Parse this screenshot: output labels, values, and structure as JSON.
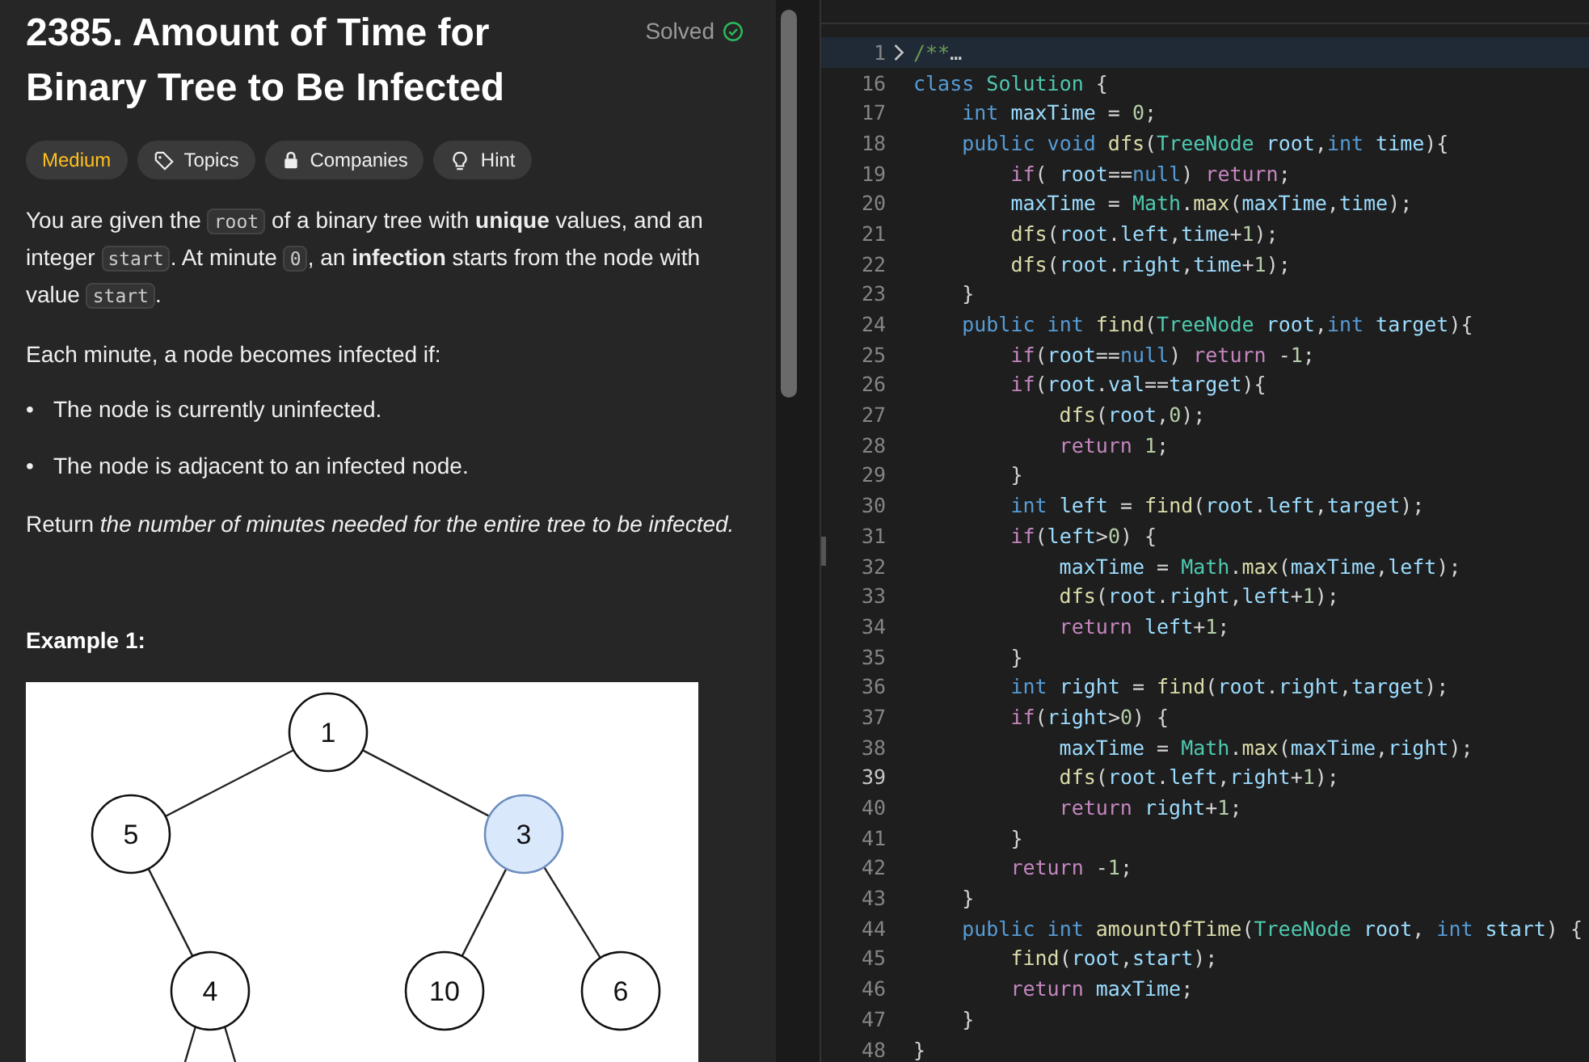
{
  "problem": {
    "title": "2385. Amount of Time for Binary Tree to Be Infected",
    "status": "Solved",
    "solved": true,
    "tags": [
      {
        "kind": "difficulty",
        "label": "Medium"
      },
      {
        "kind": "topics",
        "label": "Topics"
      },
      {
        "kind": "companies",
        "label": "Companies"
      },
      {
        "kind": "hint",
        "label": "Hint"
      }
    ],
    "paragraphs": [
      [
        {
          "text": "You are given the ",
          "kind": "text"
        },
        {
          "text": "root",
          "kind": "code"
        },
        {
          "text": " of a binary tree with **unique** values, and an integer ",
          "kind": "text"
        },
        {
          "text": "start",
          "kind": "code"
        },
        {
          "text": ". At minute ",
          "kind": "text"
        },
        {
          "text": "0",
          "kind": "code"
        },
        {
          "text": ", an **infection** starts from the node with value ",
          "kind": "text"
        },
        {
          "text": "start",
          "kind": "code"
        },
        {
          "text": ".",
          "kind": "text"
        }
      ],
      [
        {
          "text": "Each minute, a node becomes infected if:",
          "kind": "text"
        }
      ]
    ],
    "bullets": [
      {
        "marker": "•",
        "text": "The node is currently uninfected."
      },
      {
        "marker": "•",
        "text": "The node is adjacent to an infected node."
      }
    ],
    "closing": "Return *the number of minutes needed for the entire tree to be infected.*",
    "example_heading": "Example 1:",
    "tree": {
      "label": "1",
      "highlighted": false,
      "children": [
        {
          "label": "5",
          "highlighted": false,
          "children": [
            {
              "label": "4",
              "highlighted": false
            }
          ]
        },
        {
          "label": "3",
          "highlighted": true,
          "children": [
            {
              "label": "10",
              "highlighted": false
            },
            {
              "label": "6",
              "highlighted": false
            }
          ]
        }
      ]
    }
  },
  "editor": {
    "lines": [
      {
        "n": "1",
        "current": false,
        "collapsed": true,
        "tokens": [
          {
            "text": "/**",
            "kind": "comment"
          },
          {
            "text": "…",
            "kind": "plain"
          }
        ]
      },
      {
        "n": "16",
        "current": false,
        "collapsed": false,
        "tokens": [
          {
            "text": "class",
            "kind": "keyword"
          },
          {
            "text": " Solution",
            "kind": "type"
          },
          {
            "text": " {",
            "kind": "plain"
          }
        ]
      },
      {
        "n": "17",
        "current": false,
        "collapsed": false,
        "tokens": [
          {
            "text": "    int",
            "kind": "keyword"
          },
          {
            "text": " maxTime",
            "kind": "var"
          },
          {
            "text": " =",
            "kind": "plain"
          },
          {
            "text": " 0",
            "kind": "number"
          },
          {
            "text": ";",
            "kind": "plain"
          }
        ]
      },
      {
        "n": "18",
        "current": false,
        "collapsed": false,
        "tokens": [
          {
            "text": "    public",
            "kind": "keyword"
          },
          {
            "text": " void",
            "kind": "keyword"
          },
          {
            "text": " dfs",
            "kind": "func"
          },
          {
            "text": "(",
            "kind": "plain"
          },
          {
            "text": "TreeNode",
            "kind": "type"
          },
          {
            "text": " root",
            "kind": "var"
          },
          {
            "text": ",",
            "kind": "plain"
          },
          {
            "text": "int",
            "kind": "keyword"
          },
          {
            "text": " time",
            "kind": "var"
          },
          {
            "text": "){",
            "kind": "plain"
          }
        ]
      },
      {
        "n": "19",
        "current": false,
        "collapsed": false,
        "tokens": [
          {
            "text": "        if",
            "kind": "control"
          },
          {
            "text": "(",
            "kind": "plain"
          },
          {
            "text": " root",
            "kind": "var"
          },
          {
            "text": "==",
            "kind": "plain"
          },
          {
            "text": "null",
            "kind": "keyword"
          },
          {
            "text": ")",
            "kind": "plain"
          },
          {
            "text": " return",
            "kind": "control"
          },
          {
            "text": ";",
            "kind": "plain"
          }
        ]
      },
      {
        "n": "20",
        "current": false,
        "collapsed": false,
        "tokens": [
          {
            "text": "        maxTime",
            "kind": "var"
          },
          {
            "text": " =",
            "kind": "plain"
          },
          {
            "text": " Math",
            "kind": "type"
          },
          {
            "text": ".",
            "kind": "plain"
          },
          {
            "text": "max",
            "kind": "func"
          },
          {
            "text": "(",
            "kind": "plain"
          },
          {
            "text": "maxTime",
            "kind": "var"
          },
          {
            "text": ",",
            "kind": "plain"
          },
          {
            "text": "time",
            "kind": "var"
          },
          {
            "text": ");",
            "kind": "plain"
          }
        ]
      },
      {
        "n": "21",
        "current": false,
        "collapsed": false,
        "tokens": [
          {
            "text": "        dfs",
            "kind": "func"
          },
          {
            "text": "(",
            "kind": "plain"
          },
          {
            "text": "root",
            "kind": "var"
          },
          {
            "text": ".",
            "kind": "plain"
          },
          {
            "text": "left",
            "kind": "var"
          },
          {
            "text": ",",
            "kind": "plain"
          },
          {
            "text": "time",
            "kind": "var"
          },
          {
            "text": "+",
            "kind": "plain"
          },
          {
            "text": "1",
            "kind": "number"
          },
          {
            "text": ");",
            "kind": "plain"
          }
        ]
      },
      {
        "n": "22",
        "current": false,
        "collapsed": false,
        "tokens": [
          {
            "text": "        dfs",
            "kind": "func"
          },
          {
            "text": "(",
            "kind": "plain"
          },
          {
            "text": "root",
            "kind": "var"
          },
          {
            "text": ".",
            "kind": "plain"
          },
          {
            "text": "right",
            "kind": "var"
          },
          {
            "text": ",",
            "kind": "plain"
          },
          {
            "text": "time",
            "kind": "var"
          },
          {
            "text": "+",
            "kind": "plain"
          },
          {
            "text": "1",
            "kind": "number"
          },
          {
            "text": ");",
            "kind": "plain"
          }
        ]
      },
      {
        "n": "23",
        "current": false,
        "collapsed": false,
        "tokens": [
          {
            "text": "    }",
            "kind": "plain"
          }
        ]
      },
      {
        "n": "24",
        "current": false,
        "collapsed": false,
        "tokens": [
          {
            "text": "    public",
            "kind": "keyword"
          },
          {
            "text": " int",
            "kind": "keyword"
          },
          {
            "text": " find",
            "kind": "func"
          },
          {
            "text": "(",
            "kind": "plain"
          },
          {
            "text": "TreeNode",
            "kind": "type"
          },
          {
            "text": " root",
            "kind": "var"
          },
          {
            "text": ",",
            "kind": "plain"
          },
          {
            "text": "int",
            "kind": "keyword"
          },
          {
            "text": " target",
            "kind": "var"
          },
          {
            "text": "){",
            "kind": "plain"
          }
        ]
      },
      {
        "n": "25",
        "current": false,
        "collapsed": false,
        "tokens": [
          {
            "text": "        if",
            "kind": "control"
          },
          {
            "text": "(",
            "kind": "plain"
          },
          {
            "text": "root",
            "kind": "var"
          },
          {
            "text": "==",
            "kind": "plain"
          },
          {
            "text": "null",
            "kind": "keyword"
          },
          {
            "text": ")",
            "kind": "plain"
          },
          {
            "text": " return",
            "kind": "control"
          },
          {
            "text": " -",
            "kind": "plain"
          },
          {
            "text": "1",
            "kind": "number"
          },
          {
            "text": ";",
            "kind": "plain"
          }
        ]
      },
      {
        "n": "26",
        "current": false,
        "collapsed": false,
        "tokens": [
          {
            "text": "        if",
            "kind": "control"
          },
          {
            "text": "(",
            "kind": "plain"
          },
          {
            "text": "root",
            "kind": "var"
          },
          {
            "text": ".",
            "kind": "plain"
          },
          {
            "text": "val",
            "kind": "var"
          },
          {
            "text": "==",
            "kind": "plain"
          },
          {
            "text": "target",
            "kind": "var"
          },
          {
            "text": "){",
            "kind": "plain"
          }
        ]
      },
      {
        "n": "27",
        "current": false,
        "collapsed": false,
        "tokens": [
          {
            "text": "            dfs",
            "kind": "func"
          },
          {
            "text": "(",
            "kind": "plain"
          },
          {
            "text": "root",
            "kind": "var"
          },
          {
            "text": ",",
            "kind": "plain"
          },
          {
            "text": "0",
            "kind": "number"
          },
          {
            "text": ");",
            "kind": "plain"
          }
        ]
      },
      {
        "n": "28",
        "current": false,
        "collapsed": false,
        "tokens": [
          {
            "text": "            return",
            "kind": "control"
          },
          {
            "text": " 1",
            "kind": "number"
          },
          {
            "text": ";",
            "kind": "plain"
          }
        ]
      },
      {
        "n": "29",
        "current": false,
        "collapsed": false,
        "tokens": [
          {
            "text": "        }",
            "kind": "plain"
          }
        ]
      },
      {
        "n": "30",
        "current": false,
        "collapsed": false,
        "tokens": [
          {
            "text": "        int",
            "kind": "keyword"
          },
          {
            "text": " left",
            "kind": "var"
          },
          {
            "text": " =",
            "kind": "plain"
          },
          {
            "text": " find",
            "kind": "func"
          },
          {
            "text": "(",
            "kind": "plain"
          },
          {
            "text": "root",
            "kind": "var"
          },
          {
            "text": ".",
            "kind": "plain"
          },
          {
            "text": "left",
            "kind": "var"
          },
          {
            "text": ",",
            "kind": "plain"
          },
          {
            "text": "target",
            "kind": "var"
          },
          {
            "text": ");",
            "kind": "plain"
          }
        ]
      },
      {
        "n": "31",
        "current": false,
        "collapsed": false,
        "tokens": [
          {
            "text": "        if",
            "kind": "control"
          },
          {
            "text": "(",
            "kind": "plain"
          },
          {
            "text": "left",
            "kind": "var"
          },
          {
            "text": ">",
            "kind": "plain"
          },
          {
            "text": "0",
            "kind": "number"
          },
          {
            "text": ") {",
            "kind": "plain"
          }
        ]
      },
      {
        "n": "32",
        "current": false,
        "collapsed": false,
        "tokens": [
          {
            "text": "            maxTime",
            "kind": "var"
          },
          {
            "text": " =",
            "kind": "plain"
          },
          {
            "text": " Math",
            "kind": "type"
          },
          {
            "text": ".",
            "kind": "plain"
          },
          {
            "text": "max",
            "kind": "func"
          },
          {
            "text": "(",
            "kind": "plain"
          },
          {
            "text": "maxTime",
            "kind": "var"
          },
          {
            "text": ",",
            "kind": "plain"
          },
          {
            "text": "left",
            "kind": "var"
          },
          {
            "text": ");",
            "kind": "plain"
          }
        ]
      },
      {
        "n": "33",
        "current": false,
        "collapsed": false,
        "tokens": [
          {
            "text": "            dfs",
            "kind": "func"
          },
          {
            "text": "(",
            "kind": "plain"
          },
          {
            "text": "root",
            "kind": "var"
          },
          {
            "text": ".",
            "kind": "plain"
          },
          {
            "text": "right",
            "kind": "var"
          },
          {
            "text": ",",
            "kind": "plain"
          },
          {
            "text": "left",
            "kind": "var"
          },
          {
            "text": "+",
            "kind": "plain"
          },
          {
            "text": "1",
            "kind": "number"
          },
          {
            "text": ");",
            "kind": "plain"
          }
        ]
      },
      {
        "n": "34",
        "current": false,
        "collapsed": false,
        "tokens": [
          {
            "text": "            return",
            "kind": "control"
          },
          {
            "text": " left",
            "kind": "var"
          },
          {
            "text": "+",
            "kind": "plain"
          },
          {
            "text": "1",
            "kind": "number"
          },
          {
            "text": ";",
            "kind": "plain"
          }
        ]
      },
      {
        "n": "35",
        "current": false,
        "collapsed": false,
        "tokens": [
          {
            "text": "        }",
            "kind": "plain"
          }
        ]
      },
      {
        "n": "36",
        "current": false,
        "collapsed": false,
        "tokens": [
          {
            "text": "        int",
            "kind": "keyword"
          },
          {
            "text": " right",
            "kind": "var"
          },
          {
            "text": " =",
            "kind": "plain"
          },
          {
            "text": " find",
            "kind": "func"
          },
          {
            "text": "(",
            "kind": "plain"
          },
          {
            "text": "root",
            "kind": "var"
          },
          {
            "text": ".",
            "kind": "plain"
          },
          {
            "text": "right",
            "kind": "var"
          },
          {
            "text": ",",
            "kind": "plain"
          },
          {
            "text": "target",
            "kind": "var"
          },
          {
            "text": ");",
            "kind": "plain"
          }
        ]
      },
      {
        "n": "37",
        "current": false,
        "collapsed": false,
        "tokens": [
          {
            "text": "        if",
            "kind": "control"
          },
          {
            "text": "(",
            "kind": "plain"
          },
          {
            "text": "right",
            "kind": "var"
          },
          {
            "text": ">",
            "kind": "plain"
          },
          {
            "text": "0",
            "kind": "number"
          },
          {
            "text": ") {",
            "kind": "plain"
          }
        ]
      },
      {
        "n": "38",
        "current": false,
        "collapsed": false,
        "tokens": [
          {
            "text": "            maxTime",
            "kind": "var"
          },
          {
            "text": " =",
            "kind": "plain"
          },
          {
            "text": " Math",
            "kind": "type"
          },
          {
            "text": ".",
            "kind": "plain"
          },
          {
            "text": "max",
            "kind": "func"
          },
          {
            "text": "(",
            "kind": "plain"
          },
          {
            "text": "maxTime",
            "kind": "var"
          },
          {
            "text": ",",
            "kind": "plain"
          },
          {
            "text": "right",
            "kind": "var"
          },
          {
            "text": ");",
            "kind": "plain"
          }
        ]
      },
      {
        "n": "39",
        "current": true,
        "collapsed": false,
        "tokens": [
          {
            "text": "            dfs",
            "kind": "func"
          },
          {
            "text": "(",
            "kind": "plain"
          },
          {
            "text": "root",
            "kind": "var"
          },
          {
            "text": ".",
            "kind": "plain"
          },
          {
            "text": "left",
            "kind": "var"
          },
          {
            "text": ",",
            "kind": "plain"
          },
          {
            "text": "right",
            "kind": "var"
          },
          {
            "text": "+",
            "kind": "plain"
          },
          {
            "text": "1",
            "kind": "number"
          },
          {
            "text": ");",
            "kind": "plain"
          }
        ]
      },
      {
        "n": "40",
        "current": false,
        "collapsed": false,
        "tokens": [
          {
            "text": "            return",
            "kind": "control"
          },
          {
            "text": " right",
            "kind": "var"
          },
          {
            "text": "+",
            "kind": "plain"
          },
          {
            "text": "1",
            "kind": "number"
          },
          {
            "text": ";",
            "kind": "plain"
          }
        ]
      },
      {
        "n": "41",
        "current": false,
        "collapsed": false,
        "tokens": [
          {
            "text": "        }",
            "kind": "plain"
          }
        ]
      },
      {
        "n": "42",
        "current": false,
        "collapsed": false,
        "tokens": [
          {
            "text": "        return",
            "kind": "control"
          },
          {
            "text": " -",
            "kind": "plain"
          },
          {
            "text": "1",
            "kind": "number"
          },
          {
            "text": ";",
            "kind": "plain"
          }
        ]
      },
      {
        "n": "43",
        "current": false,
        "collapsed": false,
        "tokens": [
          {
            "text": "    }",
            "kind": "plain"
          }
        ]
      },
      {
        "n": "44",
        "current": false,
        "collapsed": false,
        "tokens": [
          {
            "text": "    public",
            "kind": "keyword"
          },
          {
            "text": " int",
            "kind": "keyword"
          },
          {
            "text": " amountOfTime",
            "kind": "func"
          },
          {
            "text": "(",
            "kind": "plain"
          },
          {
            "text": "TreeNode",
            "kind": "type"
          },
          {
            "text": " root",
            "kind": "var"
          },
          {
            "text": ",",
            "kind": "plain"
          },
          {
            "text": " int",
            "kind": "keyword"
          },
          {
            "text": " start",
            "kind": "var"
          },
          {
            "text": ") {",
            "kind": "plain"
          }
        ]
      },
      {
        "n": "45",
        "current": false,
        "collapsed": false,
        "tokens": [
          {
            "text": "        find",
            "kind": "func"
          },
          {
            "text": "(",
            "kind": "plain"
          },
          {
            "text": "root",
            "kind": "var"
          },
          {
            "text": ",",
            "kind": "plain"
          },
          {
            "text": "start",
            "kind": "var"
          },
          {
            "text": ");",
            "kind": "plain"
          }
        ]
      },
      {
        "n": "46",
        "current": false,
        "collapsed": false,
        "tokens": [
          {
            "text": "        return",
            "kind": "control"
          },
          {
            "text": " maxTime",
            "kind": "var"
          },
          {
            "text": ";",
            "kind": "plain"
          }
        ]
      },
      {
        "n": "47",
        "current": false,
        "collapsed": false,
        "tokens": [
          {
            "text": "    }",
            "kind": "plain"
          }
        ]
      },
      {
        "n": "48",
        "current": false,
        "collapsed": false,
        "tokens": [
          {
            "text": "}",
            "kind": "plain"
          }
        ]
      }
    ]
  }
}
